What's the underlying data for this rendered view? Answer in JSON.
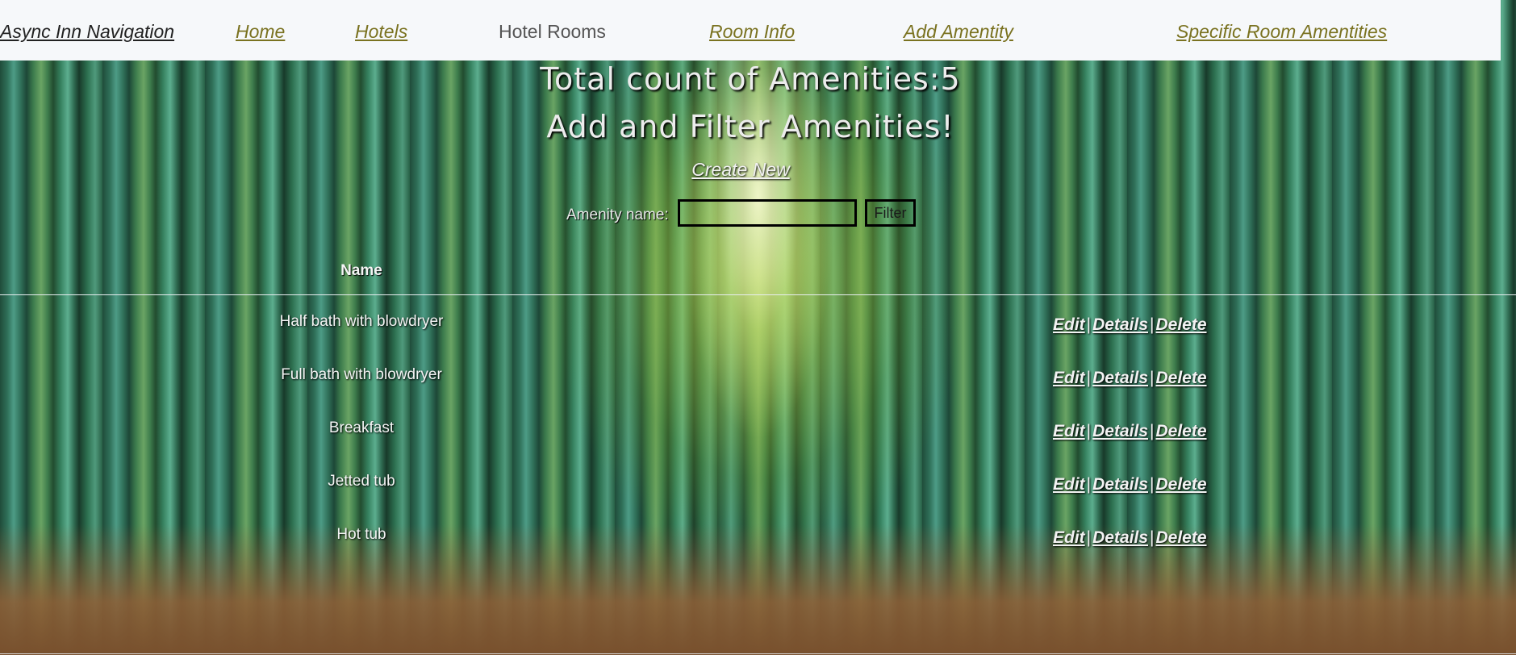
{
  "nav": {
    "brand": "Async Inn Navigation",
    "items": [
      {
        "label": "Home",
        "active": false
      },
      {
        "label": "Hotels",
        "active": false
      },
      {
        "label": "Hotel Rooms",
        "active": true
      },
      {
        "label": "Room Info",
        "active": false
      },
      {
        "label": "Add Amentity",
        "active": false
      },
      {
        "label": "Specific Room Amentities",
        "active": false
      }
    ]
  },
  "main": {
    "count_heading": "Total count of Amenities:5",
    "subheading": "Add and Filter Amenities!",
    "create_link": "Create New",
    "filter": {
      "label": "Amenity name:",
      "value": "",
      "placeholder": "",
      "button_label": "Filter"
    },
    "table": {
      "columns": [
        "Name"
      ],
      "action_labels": {
        "edit": "Edit",
        "details": "Details",
        "delete": "Delete",
        "separator": "|"
      },
      "rows": [
        {
          "name": "Half bath with blowdryer"
        },
        {
          "name": "Full bath with blowdryer"
        },
        {
          "name": "Breakfast"
        },
        {
          "name": "Jetted tub"
        },
        {
          "name": "Hot tub"
        }
      ]
    }
  },
  "colors": {
    "nav_background": "#f6f8fa",
    "nav_link": "#7a7220",
    "nav_brand": "#222222",
    "text_light": "#f2f2f2",
    "border_dark": "#000000"
  }
}
